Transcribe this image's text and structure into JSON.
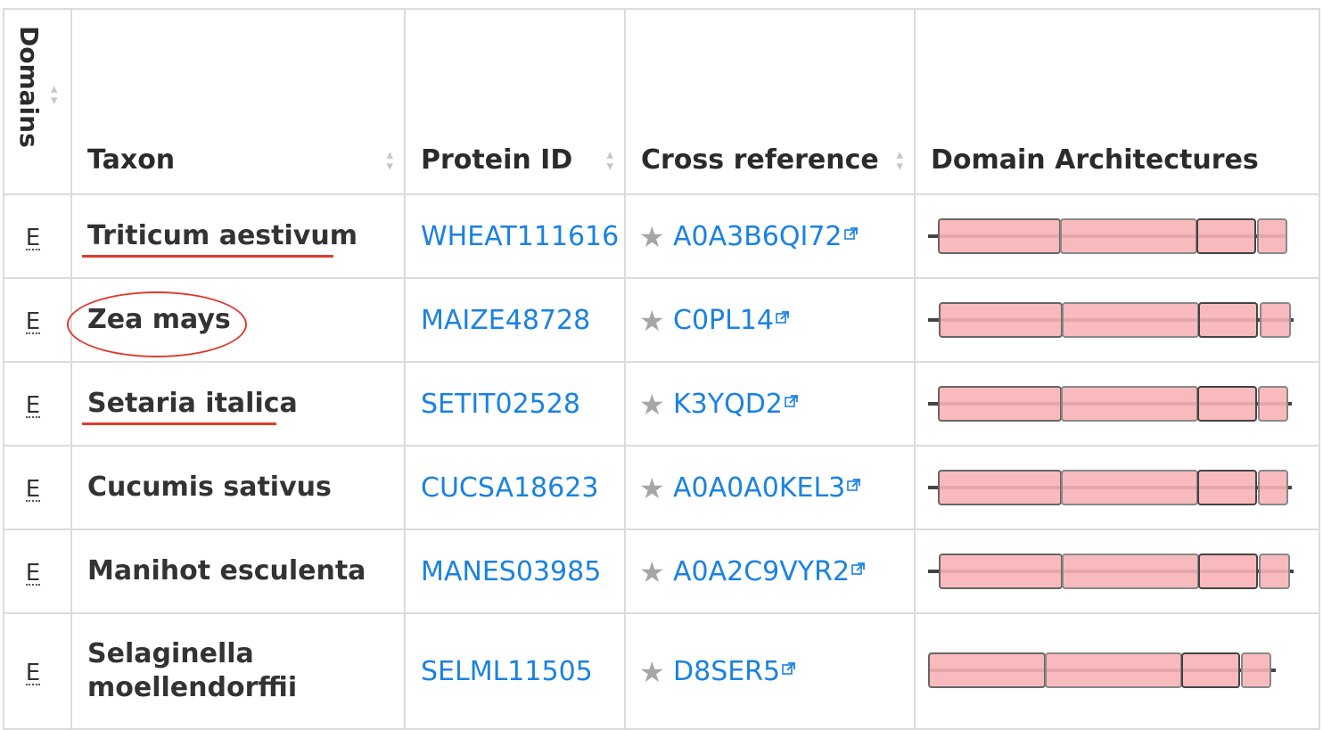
{
  "table": {
    "headers": {
      "domains": "Domains",
      "taxon": "Taxon",
      "protein_id": "Protein ID",
      "cross_reference": "Cross reference",
      "domain_architectures": "Domain Architectures"
    },
    "rows": [
      {
        "e": "E",
        "taxon": "Triticum aestivum",
        "protein_id": "WHEAT111616",
        "xref": "A0A3B6QI72",
        "annotation": "underline"
      },
      {
        "e": "E",
        "taxon": "Zea mays",
        "protein_id": "MAIZE48728",
        "xref": "C0PL14",
        "annotation": "circle"
      },
      {
        "e": "E",
        "taxon": "Setaria italica",
        "protein_id": "SETIT02528",
        "xref": "K3YQD2",
        "annotation": "underline"
      },
      {
        "e": "E",
        "taxon": "Cucumis sativus",
        "protein_id": "CUCSA18623",
        "xref": "A0A0A0KEL3",
        "annotation": "none"
      },
      {
        "e": "E",
        "taxon": "Manihot esculenta",
        "protein_id": "MANES03985",
        "xref": "A0A2C9VYR2",
        "annotation": "none"
      },
      {
        "e": "E",
        "taxon": "Selaginella moellendorffii",
        "protein_id": "SELML11505",
        "xref": "D8SER5",
        "annotation": "none"
      }
    ]
  },
  "icons": {
    "sort": "sort-arrows-icon",
    "star": "star-icon",
    "external_link": "external-link-icon"
  },
  "colors": {
    "link": "#1a82e2",
    "domain_fill": "#f7b3b6",
    "domain_border": "#555555",
    "annotation_red": "#e03a2c",
    "grid": "#dcdcdc"
  }
}
